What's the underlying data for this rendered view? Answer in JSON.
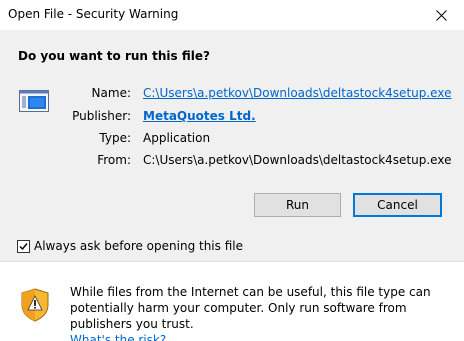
{
  "window": {
    "title": "Open File - Security Warning"
  },
  "dialog": {
    "question": "Do you want to run this file?",
    "fields": {
      "name_label": "Name:",
      "name_value": "C:\\Users\\a.petkov\\Downloads\\deltastock4setup.exe",
      "publisher_label": "Publisher:",
      "publisher_value": "MetaQuotes Ltd.",
      "type_label": "Type:",
      "type_value": "Application",
      "from_label": "From:",
      "from_value": "C:\\Users\\a.petkov\\Downloads\\deltastock4setup.exe"
    },
    "buttons": {
      "run": "Run",
      "cancel": "Cancel"
    },
    "checkbox": {
      "label": "Always ask before opening this file",
      "checked": true
    },
    "warning": {
      "text": "While files from the Internet can be useful, this file type can potentially harm your computer. Only run software from publishers you trust.",
      "link": "What's the risk?"
    },
    "icons": {
      "file": "executable-file-icon",
      "shield": "security-shield-icon",
      "close": "close-icon"
    },
    "colors": {
      "link": "#0066cc",
      "accent": "#0078d7",
      "body_bg": "#f0f0f0"
    }
  }
}
